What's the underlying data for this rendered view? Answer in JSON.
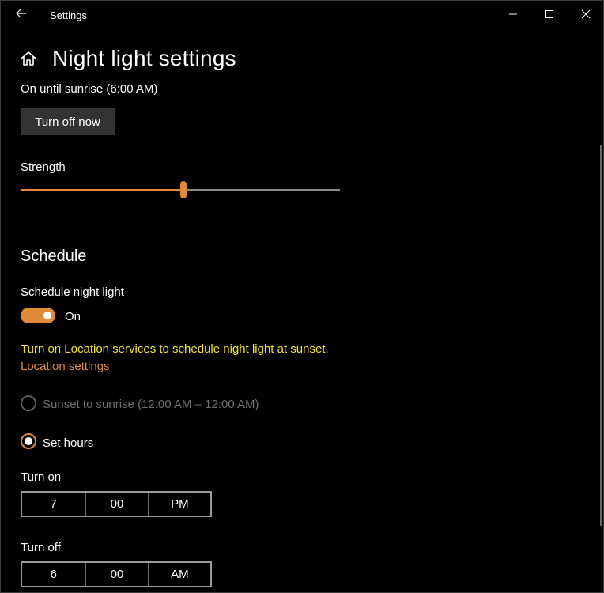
{
  "window": {
    "title": "Settings",
    "icons": {
      "back": "arrow-left-icon",
      "minimize": "minimize-icon",
      "maximize": "maximize-icon",
      "close": "close-icon",
      "home": "home-icon"
    }
  },
  "header": {
    "title": "Night light settings",
    "status": "On until sunrise (6:00 AM)",
    "turn_off_button": "Turn off now"
  },
  "strength": {
    "label": "Strength",
    "value_fraction": 0.51
  },
  "schedule": {
    "heading": "Schedule",
    "label": "Schedule night light",
    "toggle_state": "On",
    "warning": "Turn on Location services to schedule night light at sunset.",
    "location_link": "Location settings",
    "options": [
      {
        "label": "Sunset to sunrise (12:00 AM – 12:00 AM)",
        "selected": false,
        "disabled": true
      },
      {
        "label": "Set hours",
        "selected": true,
        "disabled": false
      }
    ],
    "turn_on": {
      "label": "Turn on",
      "hour": "7",
      "minute": "00",
      "period": "PM"
    },
    "turn_off": {
      "label": "Turn off",
      "hour": "6",
      "minute": "00",
      "period": "AM"
    }
  },
  "colors": {
    "accent": "#e08a3c",
    "warning": "#f0e22e",
    "background": "#000000"
  }
}
